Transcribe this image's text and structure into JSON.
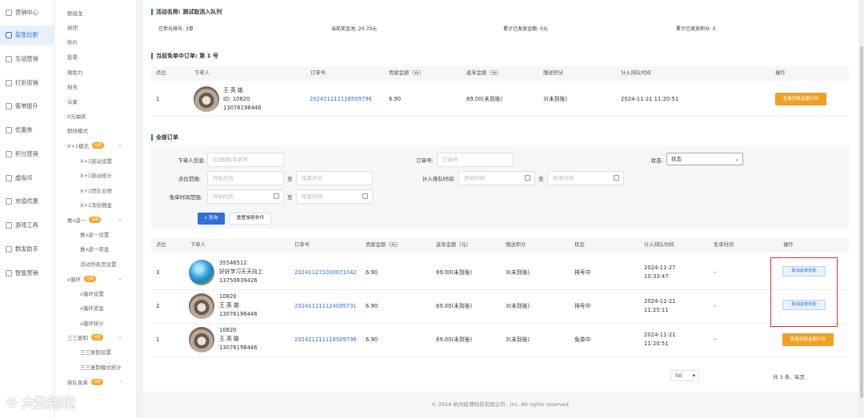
{
  "sidebar": {
    "items": [
      {
        "label": "营销中心",
        "icon": "store-icon"
      },
      {
        "label": "裂变拉新",
        "icon": "share-icon",
        "active": true
      },
      {
        "label": "互动营销",
        "icon": "interaction-icon"
      },
      {
        "label": "打折促销",
        "icon": "discount-icon"
      },
      {
        "label": "客单提升",
        "icon": "chart-icon"
      },
      {
        "label": "优惠券",
        "icon": "coupon-icon"
      },
      {
        "label": "积分营销",
        "icon": "points-icon"
      },
      {
        "label": "虚拟币",
        "icon": "coin-icon"
      },
      {
        "label": "充值优惠",
        "icon": "recharge-icon"
      },
      {
        "label": "游戏工具",
        "icon": "game-icon"
      },
      {
        "label": "群发助手",
        "icon": "broadcast-icon"
      },
      {
        "label": "智能营销",
        "icon": "smart-icon"
      }
    ]
  },
  "subnav": {
    "items": [
      {
        "label": "群接龙"
      },
      {
        "label": "拼团"
      },
      {
        "label": "砍价"
      },
      {
        "label": "投票"
      },
      {
        "label": "微助力"
      },
      {
        "label": "拍卖"
      },
      {
        "label": "众筹"
      },
      {
        "label": "0元抽奖"
      },
      {
        "label": "即拼模式"
      },
      {
        "label": "X+1模式",
        "badge": "付费",
        "chev": "⌄"
      },
      {
        "label": "X+1链动设置",
        "l2": true
      },
      {
        "label": "X+1链动统计",
        "l2": true
      },
      {
        "label": "X+1团队业绩",
        "l2": true
      },
      {
        "label": "X+1冻结佣金",
        "l2": true
      },
      {
        "label": "推x返一",
        "badge": "付费",
        "chev": "⌄"
      },
      {
        "label": "推x返一设置",
        "l2": true
      },
      {
        "label": "推x返一资金",
        "l2": true
      },
      {
        "label": "活动列表页设置",
        "l2": true
      },
      {
        "label": "x循环",
        "badge": "付费",
        "chev": "⌄"
      },
      {
        "label": "x循环设置",
        "l2": true
      },
      {
        "label": "x循环资金",
        "l2": true
      },
      {
        "label": "x循环统计",
        "l2": true
      },
      {
        "label": "三三复制",
        "badge": "付费",
        "chev": "⌄"
      },
      {
        "label": "三三复制设置",
        "l2": true
      },
      {
        "label": "三三复制模式统计",
        "l2": true
      },
      {
        "label": "排队免单",
        "badge": "付费",
        "chev": "›"
      }
    ]
  },
  "activity": {
    "title": "活动名称: 测试取消入队列",
    "join_count": "已参与排号: 3单",
    "pool": "当前奖金池: 20.70元",
    "total_paid": "累计已发放金额: 0元",
    "total_points": "累计已发放积分: 0"
  },
  "current_free": {
    "title": "当前免单中订单: 第 1 号",
    "headers": [
      "点位",
      "下单人",
      "订单号",
      "贡献金额（元）",
      "返单金额（元）",
      "赠送积分",
      "计入排队时间",
      "操作"
    ],
    "row": {
      "position": "1",
      "name": "王 英 雄",
      "id": "ID: 10820",
      "phone": "13076198446",
      "order": "2024112111185​09796",
      "contrib": "6.90",
      "refund": "69.00(未到账)",
      "points": "3(未到账)",
      "time": "2024-11-21 11:20:51",
      "action": "查看贡献金额分布"
    }
  },
  "all_orders": {
    "title": "全部订单",
    "filters": {
      "buyer_label": "下单人信息:",
      "buyer_placeholder": "ID/昵称/手机号",
      "order_label": "订单号:",
      "order_placeholder": "订单号",
      "status_label": "状态:",
      "status_value": "状态",
      "pos_label": "点位范围:",
      "pos_start": "开始点位",
      "pos_end": "结束点位",
      "to": "至",
      "queue_label": "计入排队时间:",
      "start_time": "开始时间",
      "end_time": "结束时间",
      "free_label": "免单时间范围:",
      "search": "查询",
      "reset": "重置搜索条件"
    },
    "headers": [
      "点位",
      "下单人",
      "订单号",
      "贡献金额（元）",
      "返单金额（元）",
      "赠送积分",
      "状态",
      "计入排队时间",
      "免单时间",
      "操作"
    ],
    "rows": [
      {
        "position": "3",
        "avatar": "globe",
        "l1": "35546512",
        "l2": "好好学习天天向上",
        "l3": "13750839426",
        "order": "2024112710300710​42",
        "contrib": "6.90",
        "refund": "69.00(未到账)",
        "points": "3(未到账)",
        "status": "排号中",
        "time1": "2024-11-27",
        "time2": "10:33:47",
        "free": "–",
        "action": "取消返单奖励",
        "action_type": "light"
      },
      {
        "position": "2",
        "avatar": "racoon",
        "l1": "10820",
        "l2": "王 英 雄",
        "l3": "13076198446",
        "order": "2024112111240957​31",
        "contrib": "6.90",
        "refund": "69.00(未到账)",
        "points": "3(未到账)",
        "status": "排号中",
        "time1": "2024-11-21",
        "time2": "11:25:11",
        "free": "–",
        "action": "取消返单奖励",
        "action_type": "light"
      },
      {
        "position": "1",
        "avatar": "racoon",
        "l1": "10820",
        "l2": "王 英 雄",
        "l3": "13076198446",
        "order": "2024112111185097​96",
        "contrib": "6.90",
        "refund": "69.00(未到账)",
        "points": "3(未到账)",
        "status": "免单中",
        "time1": "2024-11-21",
        "time2": "11:20:51",
        "free": "–",
        "action": "查看贡献金额分布",
        "action_type": "orange"
      }
    ],
    "pager": {
      "total": "共 3 条,",
      "per_page": "每页",
      "size": "50"
    }
  },
  "footer": "© 2024 杭州启博科技有限公司 , Inc. All rights reserved.",
  "watermark": "大数跨境",
  "colors": {
    "accent": "#2f6fd8",
    "orange": "#f0a024",
    "highlight": "#e03030"
  }
}
